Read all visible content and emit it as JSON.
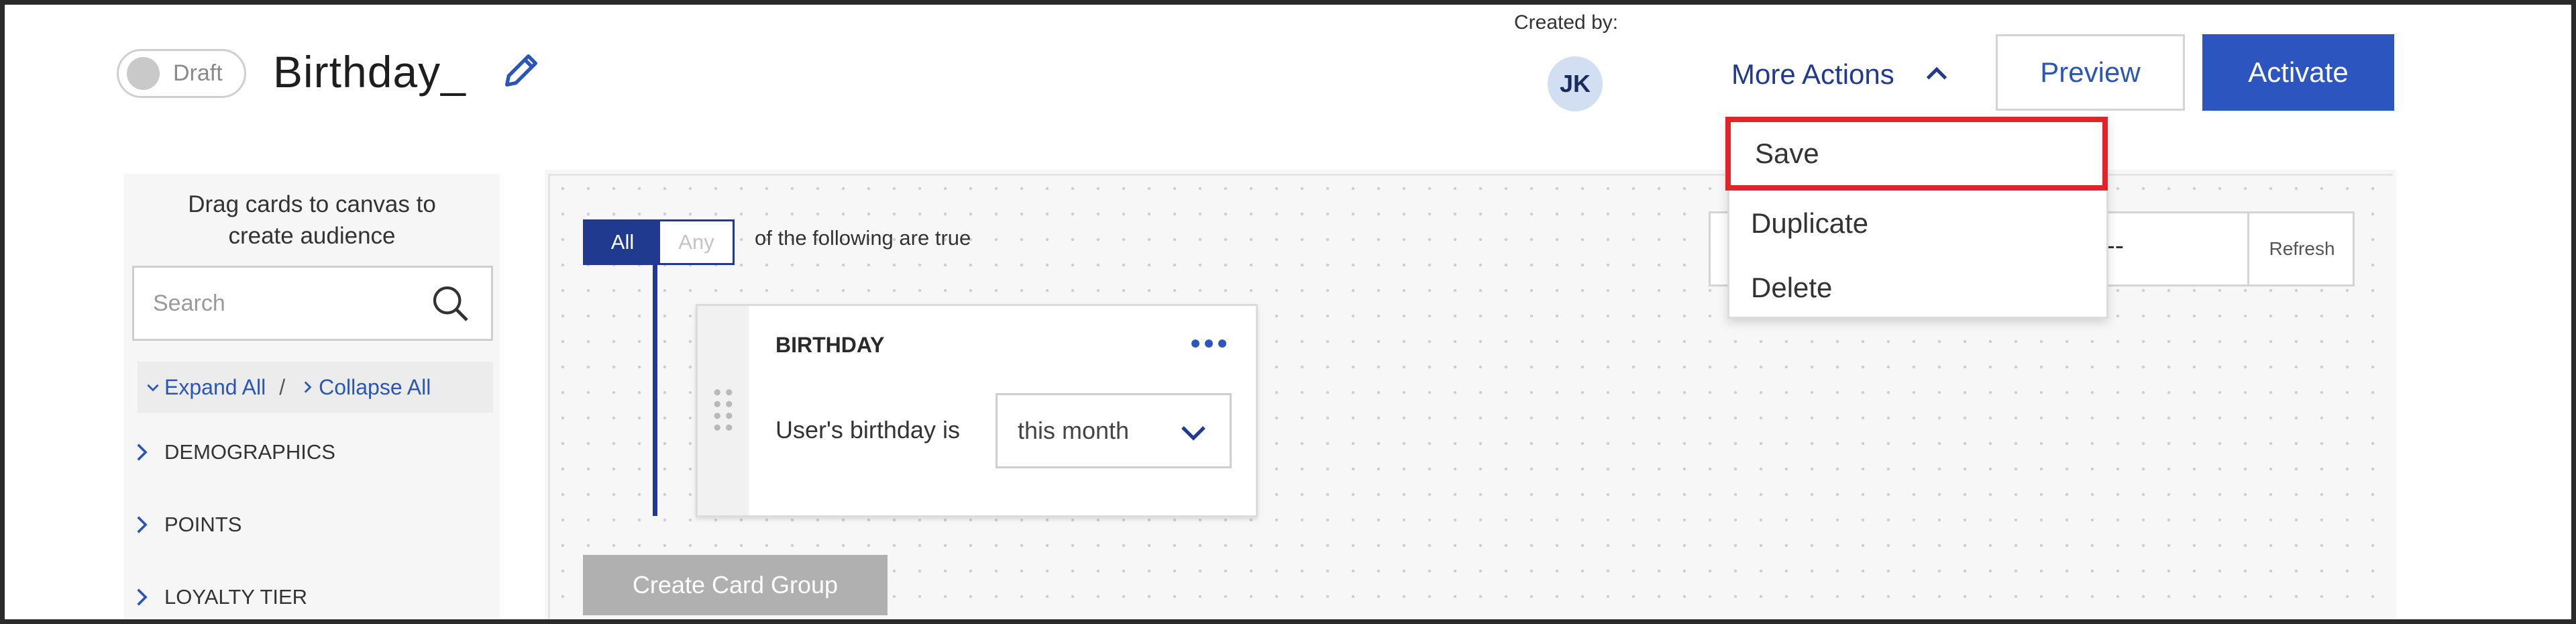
{
  "header": {
    "status_label": "Draft",
    "audience_title": "Birthday_",
    "created_by_label": "Created by:",
    "creator_initials": "JK",
    "more_actions_label": "More Actions",
    "preview_label": "Preview",
    "activate_label": "Activate"
  },
  "more_actions_menu": {
    "items": [
      {
        "label": "Save",
        "highlighted": true
      },
      {
        "label": "Duplicate"
      },
      {
        "label": "Delete"
      }
    ],
    "highlight_color": "#e3232b"
  },
  "sidebar": {
    "help_text_line1": "Drag cards to canvas to",
    "help_text_line2": "create audience",
    "search_placeholder": "Search",
    "expand_all_label": "Expand All",
    "separator": "/",
    "collapse_all_label": "Collapse All",
    "categories": [
      "DEMOGRAPHICS",
      "POINTS",
      "LOYALTY TIER"
    ]
  },
  "canvas": {
    "match_all_label": "All",
    "match_any_label": "Any",
    "match_selected": "All",
    "match_suffix": "of the following are true",
    "size_text": "ze: --",
    "refresh_label": "Refresh",
    "create_card_group_label": "Create Card Group",
    "card": {
      "title": "BIRTHDAY",
      "condition_label": "User's birthday is",
      "condition_value": "this month"
    }
  },
  "colors": {
    "primary": "#2d55c0",
    "navy": "#1f3a8f",
    "link": "#2a56b8",
    "disabled": "#b0b0b0"
  }
}
